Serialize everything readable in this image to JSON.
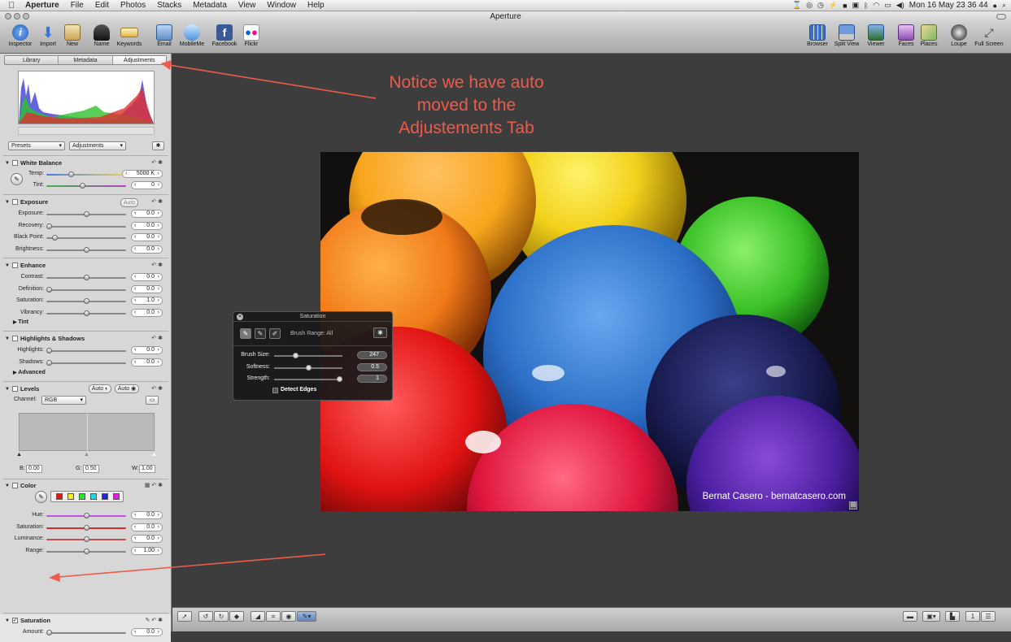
{
  "menubar": {
    "apple_icon": "apple-icon",
    "app_name": "Aperture",
    "items": [
      "File",
      "Edit",
      "Photos",
      "Stacks",
      "Metadata",
      "View",
      "Window",
      "Help"
    ],
    "clock": "Mon 16 May  23 36 44"
  },
  "window": {
    "title": "Aperture"
  },
  "toolbar": {
    "left": [
      "Inspector",
      "Import",
      "New",
      "Name",
      "Keywords",
      "Email",
      "MobileMe",
      "Facebook",
      "Flickr"
    ],
    "right": [
      "Browser",
      "Split View",
      "Viewer",
      "Faces",
      "Places",
      "Loupe",
      "Full Screen"
    ]
  },
  "inspector": {
    "tabs": [
      "Library",
      "Metadata",
      "Adjustments"
    ],
    "active_tab": "Adjustments",
    "presets_label": "Presets",
    "adjustments_label": "Adjustments",
    "white_balance": {
      "title": "White Balance",
      "temp_label": "Temp:",
      "temp_value": "5000 K",
      "temp_level": 0.3,
      "tint_label": "Tint:",
      "tint_value": "0",
      "tint_level": 0.45
    },
    "exposure": {
      "title": "Exposure",
      "auto_label": "Auto",
      "rows": [
        {
          "label": "Exposure:",
          "value": "0.0",
          "level": 0.5
        },
        {
          "label": "Recovery:",
          "value": "0.0",
          "level": 0.0
        },
        {
          "label": "Black Point:",
          "value": "0.0",
          "level": 0.08
        },
        {
          "label": "Brightness:",
          "value": "0.0",
          "level": 0.5
        }
      ]
    },
    "enhance": {
      "title": "Enhance",
      "rows": [
        {
          "label": "Contrast:",
          "value": "0.0",
          "level": 0.5
        },
        {
          "label": "Definition:",
          "value": "0.0",
          "level": 0.0
        },
        {
          "label": "Saturation:",
          "value": "1.0",
          "level": 0.5
        },
        {
          "label": "Vibrancy:",
          "value": "0.0",
          "level": 0.5
        }
      ],
      "tint_label": "Tint"
    },
    "highlights_shadows": {
      "title": "Highlights & Shadows",
      "rows": [
        {
          "label": "Highlights:",
          "value": "0.0",
          "level": 0.0
        },
        {
          "label": "Shadows:",
          "value": "0.0",
          "level": 0.0
        }
      ],
      "advanced_label": "Advanced"
    },
    "levels": {
      "title": "Levels",
      "auto_mono_label": "Auto",
      "auto_color_label": "Auto",
      "channel_label": "Channel:",
      "channel_value": "RGB",
      "b_label": "B:",
      "b_value": "0.00",
      "g_label": "G:",
      "g_value": "0.50",
      "w_label": "W:",
      "w_value": "1.00"
    },
    "color": {
      "title": "Color",
      "swatches": [
        "#e81515",
        "#f2ef25",
        "#26e62a",
        "#22d6e0",
        "#2325d8",
        "#e81ce0"
      ],
      "rows": [
        {
          "label": "Hue:",
          "value": "0.0",
          "level": 0.5,
          "track": "#c050e0"
        },
        {
          "label": "Saturation:",
          "value": "0.0",
          "level": 0.5,
          "track": "#d33030"
        },
        {
          "label": "Luminance:",
          "value": "0.0",
          "level": 0.5,
          "track": "#c25050"
        },
        {
          "label": "Range:",
          "value": "1.00",
          "level": 0.5,
          "track": "#888888"
        }
      ]
    },
    "saturation_brick": {
      "title": "Saturation",
      "amount_label": "Amount:",
      "amount_value": "0.0",
      "amount_level": 0.0
    }
  },
  "hud": {
    "title": "Saturation",
    "brush_range": "Brush Range: All",
    "rows": [
      {
        "label": "Brush Size:",
        "value": "247",
        "level": 0.3
      },
      {
        "label": "Softness:",
        "value": "0.5",
        "level": 0.5
      },
      {
        "label": "Strength:",
        "value": "1",
        "level": 1.0
      }
    ],
    "detect_edges_label": "Detect Edges"
  },
  "viewer": {
    "photo_credit": "Bernat Casero - bernatcasero.com",
    "annotation": "Notice we have auto moved to the Adjustements Tab"
  },
  "colors": {
    "annotation": "#ee5a4b",
    "viewer_bg": "#3d3d3d",
    "sidebar_bg": "#d7d7d7"
  }
}
